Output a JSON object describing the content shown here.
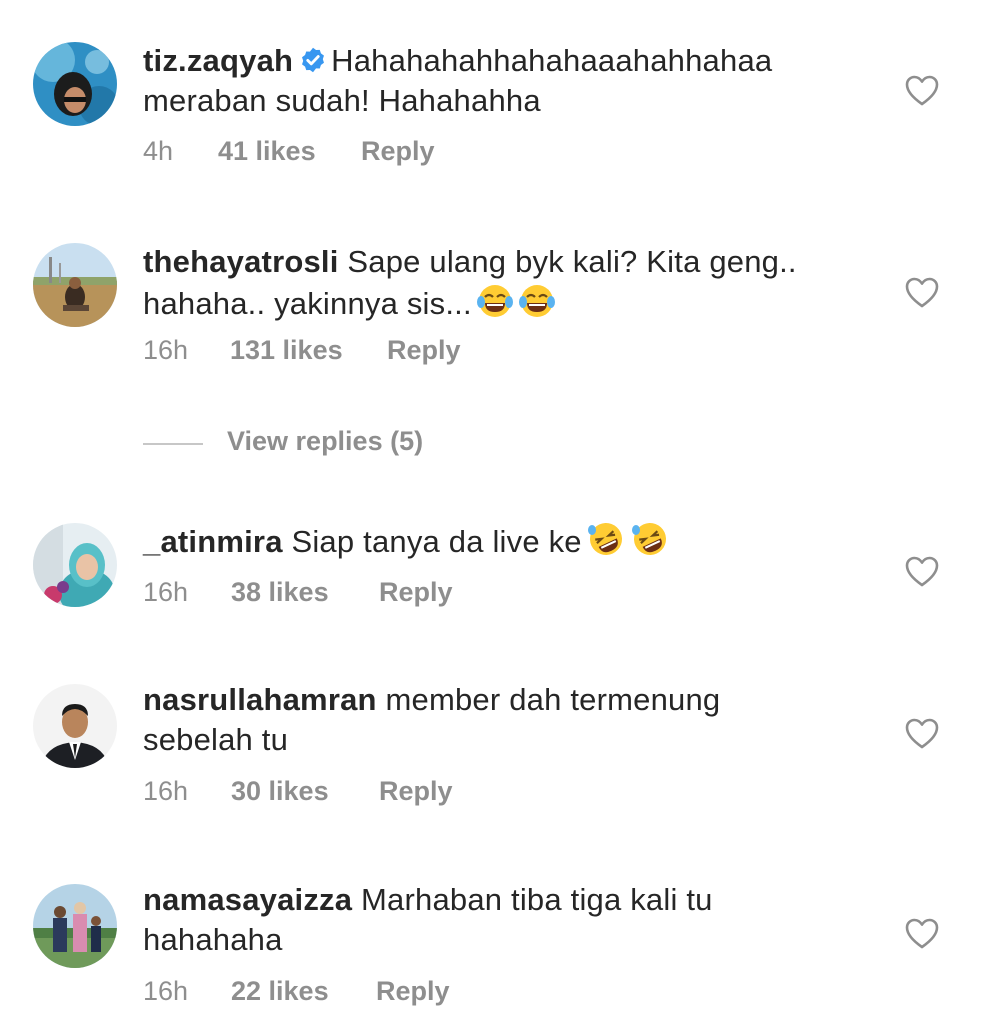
{
  "comments": [
    {
      "username": "tiz.zaqyah",
      "verified": true,
      "text_line1": "Hahahahahhahahaaahahhahaa",
      "text_line2": "meraban sudah! Hahahahha",
      "time": "4h",
      "likes": "41 likes",
      "reply": "Reply",
      "emojis": []
    },
    {
      "username": "thehayatrosli",
      "verified": false,
      "text_line1": "Sape ulang byk kali? Kita geng..",
      "text_line2": "hahaha.. yakinnya sis...",
      "time": "16h",
      "likes": "131 likes",
      "reply": "Reply",
      "emojis": [
        "tears-of-joy-emoji",
        "tears-of-joy-emoji"
      ]
    },
    {
      "username": "_atinmira",
      "verified": false,
      "text_line1": "Siap tanya da live ke",
      "text_line2": "",
      "time": "16h",
      "likes": "38 likes",
      "reply": "Reply",
      "emojis": [
        "rolling-laughing-emoji",
        "rolling-laughing-emoji"
      ]
    },
    {
      "username": "nasrullahamran",
      "verified": false,
      "text_line1": "member dah termenung",
      "text_line2": "sebelah tu",
      "time": "16h",
      "likes": "30 likes",
      "reply": "Reply",
      "emojis": []
    },
    {
      "username": "namasayaizza",
      "verified": false,
      "text_line1": "Marhaban tiba tiga kali tu",
      "text_line2": "hahahaha",
      "time": "16h",
      "likes": "22 likes",
      "reply": "Reply",
      "emojis": []
    }
  ],
  "view_replies": "View replies (5)",
  "icons": {
    "like": "heart-outline-icon",
    "verified": "verified-badge-icon"
  },
  "colors": {
    "text": "#262626",
    "meta": "#8e8e8e",
    "verified": "#3897f0",
    "heart": "#8e8e8e",
    "background": "#ffffff"
  }
}
